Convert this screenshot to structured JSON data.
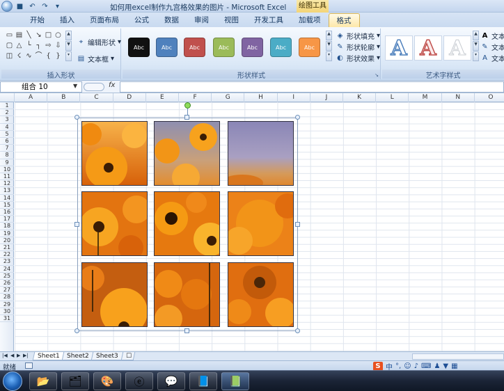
{
  "window": {
    "title": "如何用excel制作九宫格效果的图片 - Microsoft Excel",
    "context_tab_title": "绘图工具"
  },
  "tabs": [
    {
      "label": "开始"
    },
    {
      "label": "插入"
    },
    {
      "label": "页面布局"
    },
    {
      "label": "公式"
    },
    {
      "label": "数据"
    },
    {
      "label": "审阅"
    },
    {
      "label": "视图"
    },
    {
      "label": "开发工具"
    },
    {
      "label": "加载项"
    },
    {
      "label": "格式",
      "active": true
    }
  ],
  "ribbon": {
    "insert_shapes": {
      "label": "插入形状",
      "edit_shape": "编辑形状",
      "textbox": "文本框"
    },
    "shape_styles": {
      "label": "形状样式",
      "swatches": [
        {
          "text": "Abc",
          "color": "#111111"
        },
        {
          "text": "Abc",
          "color": "#4f81bd"
        },
        {
          "text": "Abc",
          "color": "#c0504d"
        },
        {
          "text": "Abc",
          "color": "#9bbb59"
        },
        {
          "text": "Abc",
          "color": "#8064a2"
        },
        {
          "text": "Abc",
          "color": "#4bacc6"
        },
        {
          "text": "Abc",
          "color": "#f79646"
        }
      ],
      "fill": "形状填充",
      "outline": "形状轮廓",
      "effects": "形状效果"
    },
    "wordart": {
      "label": "艺术字样式",
      "samples": [
        "A",
        "A",
        "A"
      ],
      "text_fill": "文本",
      "text_outline": "文本",
      "text_effects": "文本"
    }
  },
  "formula_bar": {
    "name_box": "组合 10",
    "fx": "fx",
    "value": ""
  },
  "grid": {
    "columns": [
      "A",
      "B",
      "C",
      "D",
      "E",
      "F",
      "G",
      "H",
      "I",
      "J",
      "K",
      "L",
      "M",
      "N",
      "O"
    ],
    "rows": [
      "1",
      "2",
      "3",
      "4",
      "5",
      "6",
      "7",
      "8",
      "9",
      "10",
      "11",
      "12",
      "13",
      "14",
      "15",
      "16",
      "17",
      "18",
      "19",
      "20",
      "21",
      "22",
      "23",
      "24",
      "25",
      "26",
      "27",
      "28",
      "29",
      "30",
      "31"
    ]
  },
  "sheets": [
    {
      "label": "Sheet1",
      "active": true
    },
    {
      "label": "Sheet2"
    },
    {
      "label": "Sheet3"
    }
  ],
  "status": {
    "text": "就绪",
    "ime": "中"
  },
  "taskbar": {
    "apps": [
      {
        "icon": "folder-icon"
      },
      {
        "icon": "library-icon"
      },
      {
        "icon": "paint-icon"
      },
      {
        "icon": "ie-icon"
      },
      {
        "icon": "wechat-icon"
      },
      {
        "icon": "notebook-icon"
      },
      {
        "icon": "excel-icon",
        "active": true
      }
    ]
  }
}
